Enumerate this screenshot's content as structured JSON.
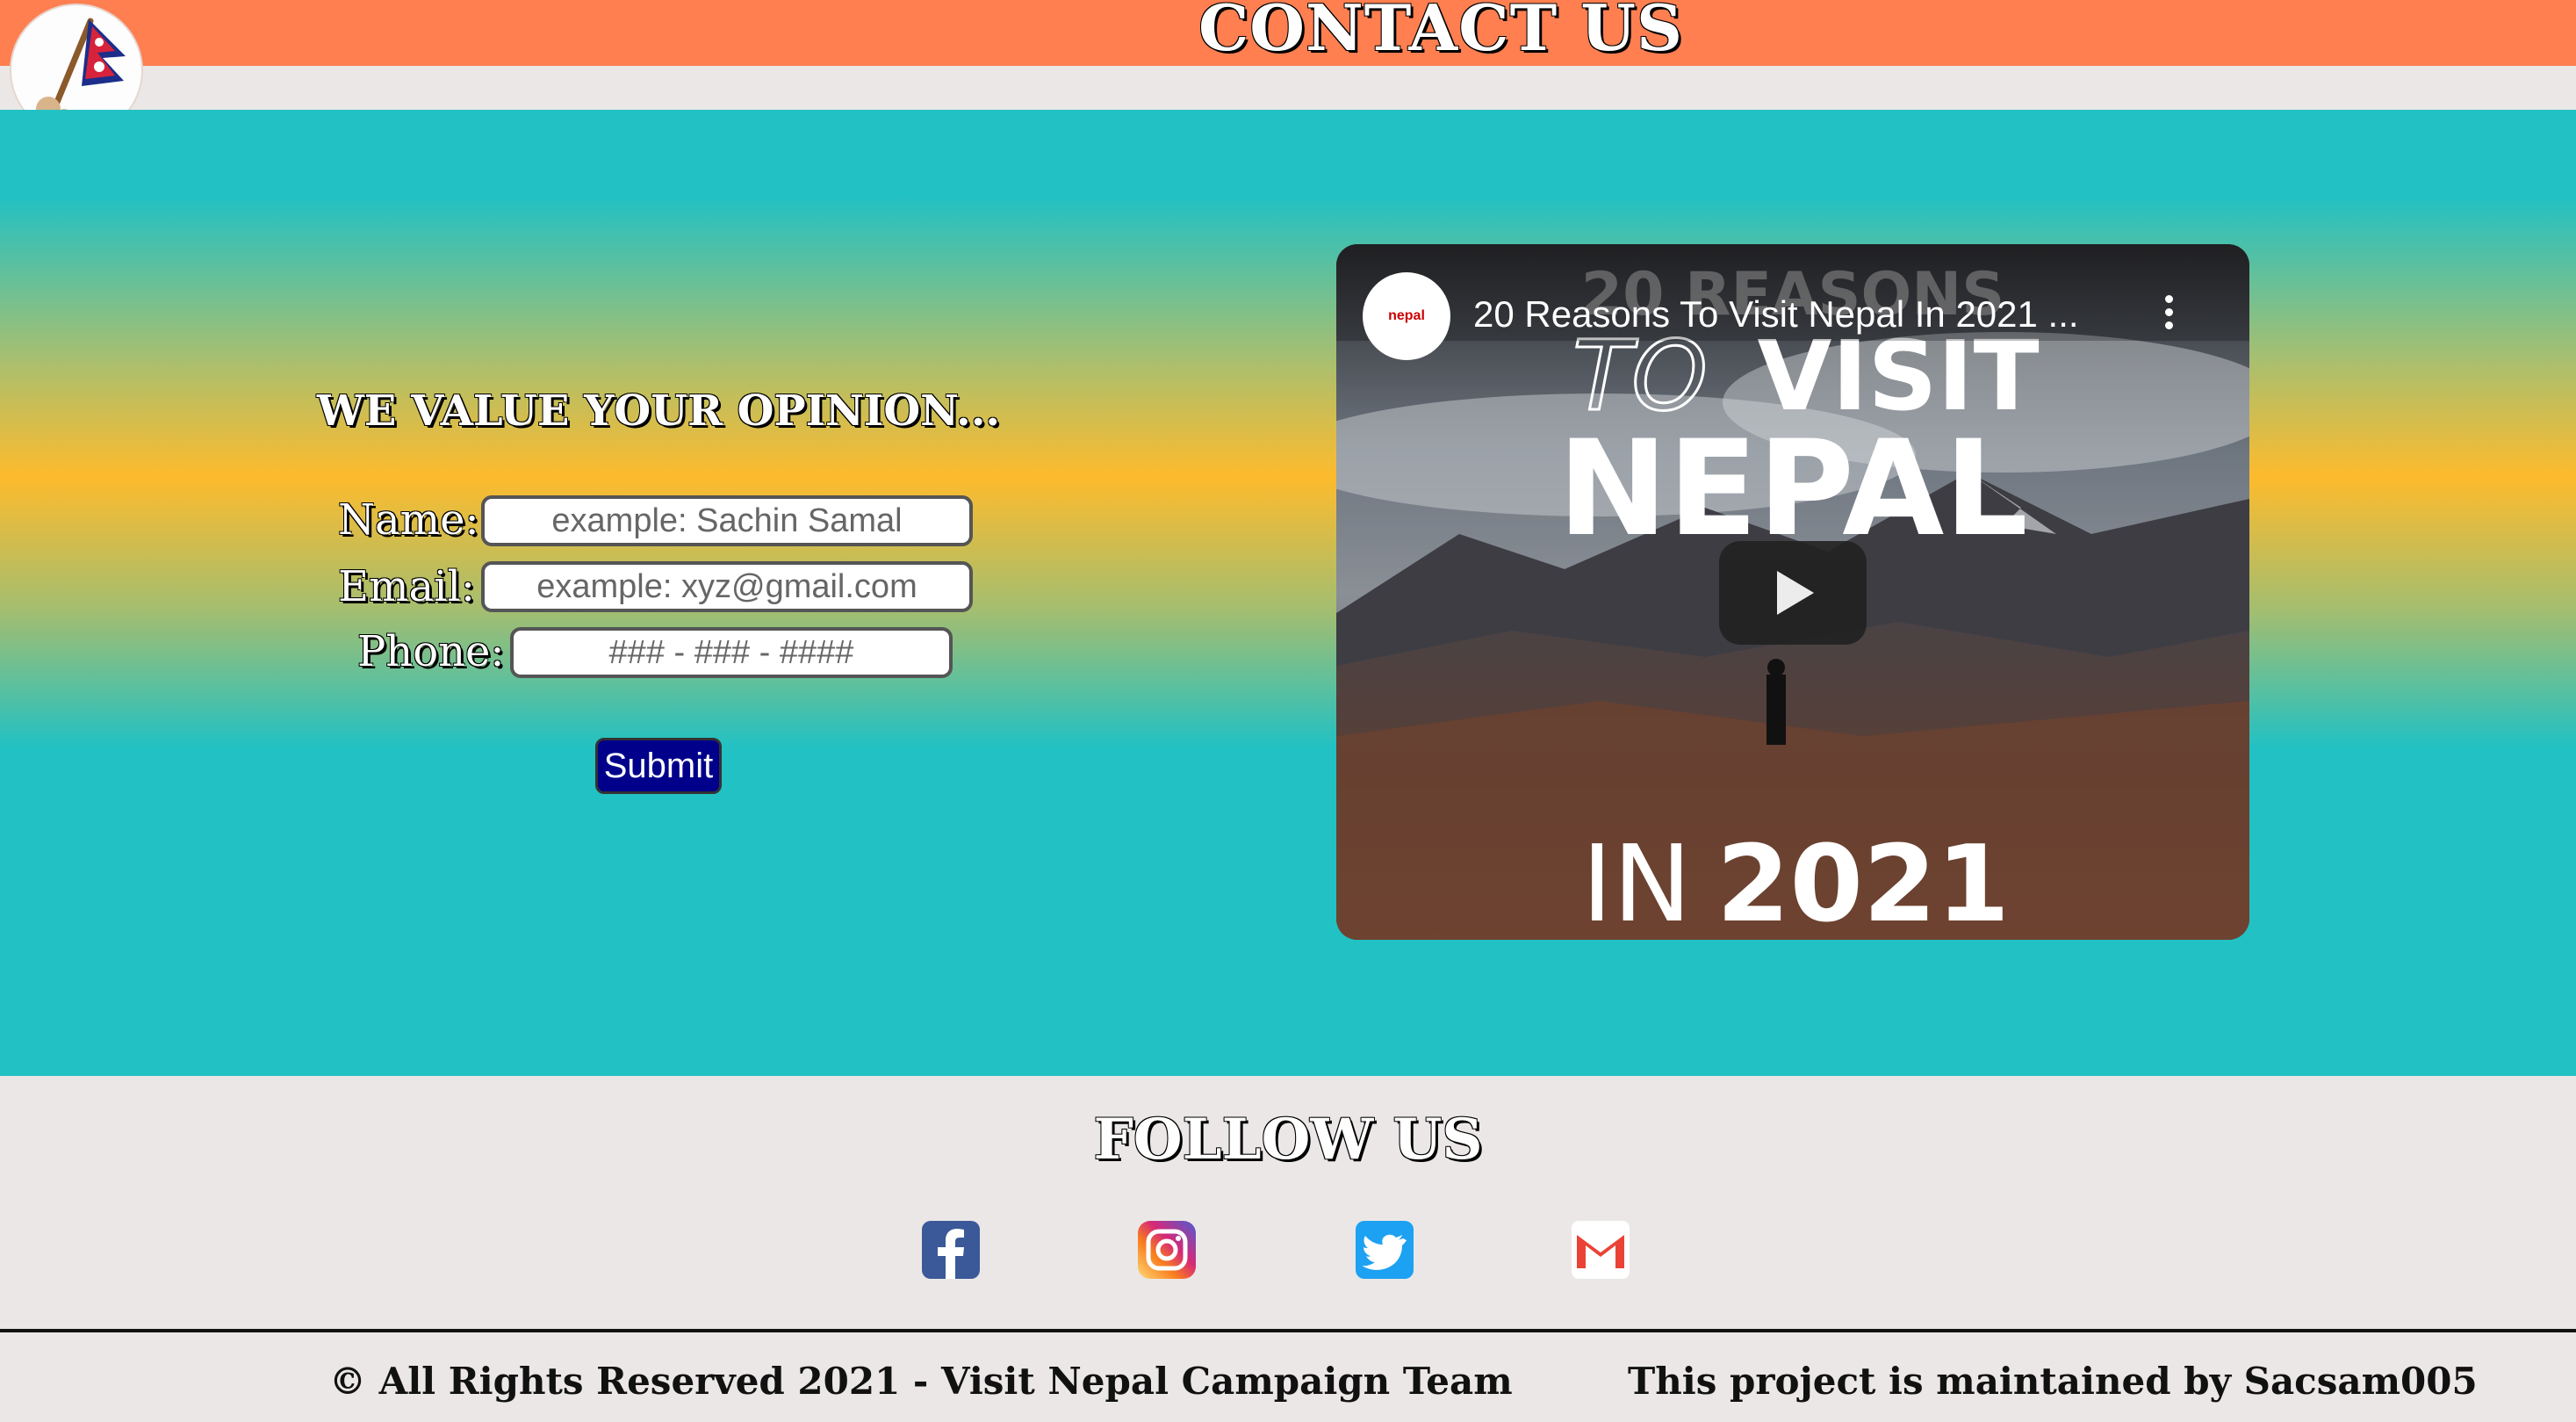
{
  "header": {
    "title": "CONTACT US"
  },
  "form": {
    "heading": "WE VALUE YOUR OPINION...",
    "name_label": "Name:",
    "name_placeholder": "example: Sachin Samal",
    "email_label": "Email:",
    "email_placeholder": "example: xyz@gmail.com",
    "phone_label": "Phone:",
    "phone_placeholder": "### - ### - ####",
    "submit_label": "Submit"
  },
  "video": {
    "title": "20 Reasons To Visit Nepal In 2021 ...",
    "channel_logo_text": "nepal",
    "thumb_line1": "20 REASONS",
    "thumb_line2a": "TO",
    "thumb_line2b": "VISIT",
    "thumb_line3": "NEPAL",
    "thumb_line4a": "IN",
    "thumb_line4b": "2021"
  },
  "footer": {
    "follow_title": "FOLLOW US",
    "social": [
      "facebook-icon",
      "instagram-icon",
      "twitter-icon",
      "gmail-icon"
    ],
    "copyright": "© All Rights Reserved 2021 - Visit Nepal Campaign Team",
    "maintained": "This project is maintained by Sacsam005"
  },
  "colors": {
    "header_bg": "#ff7f50",
    "hero_teal": "#22c1c3",
    "hero_gold": "#fdbb2d",
    "submit_bg": "#00008b",
    "page_bg": "#ebe7e6"
  }
}
